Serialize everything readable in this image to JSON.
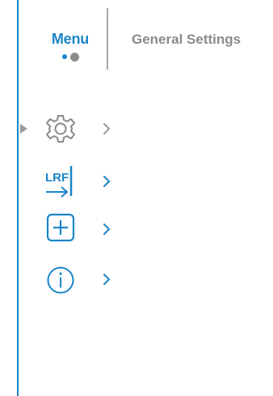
{
  "header": {
    "menu_tab_label": "Menu",
    "settings_tab_label": "General Settings"
  },
  "items": [
    {
      "name": "general-settings",
      "icon": "gear-icon",
      "chevron_color": "#9a9a9a"
    },
    {
      "name": "lrf",
      "icon": "lrf-icon",
      "label": "LRF",
      "chevron_color": "#1a86c8"
    },
    {
      "name": "add",
      "icon": "plus-icon",
      "chevron_color": "#1a86c8"
    },
    {
      "name": "info",
      "icon": "info-icon",
      "chevron_color": "#1a86c8"
    }
  ],
  "colors": {
    "accent": "#1a86c8",
    "inactive": "#8a8a8a"
  }
}
